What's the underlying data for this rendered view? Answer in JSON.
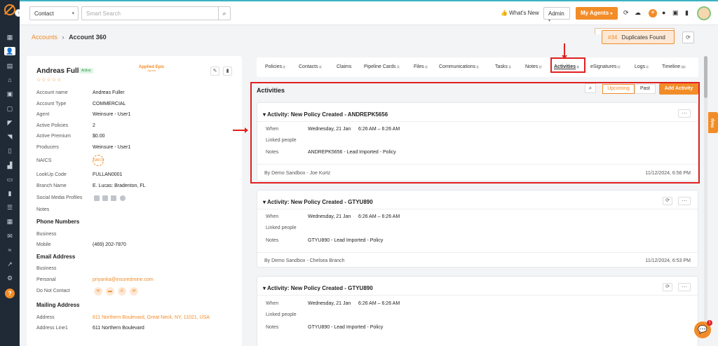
{
  "topbar": {
    "select_label": "Contact",
    "search_placeholder": "Smart Search",
    "whats_new": "👍 What's New",
    "admin_label": "Admin",
    "my_agents_label": "My Agents"
  },
  "breadcrumb": {
    "parent": "Accounts",
    "current": "Account 360"
  },
  "duplicates": {
    "number": "#34",
    "label": "Duplicates Found"
  },
  "account": {
    "name": "Andreas Fuller",
    "status": "Active",
    "stars": "☆☆☆☆☆",
    "applied_epic": "Applied Epic",
    "applied_epic_sub": "Synced",
    "fields": [
      {
        "label": "Account name",
        "value": "Andreas Fuller"
      },
      {
        "label": "Account Type",
        "value": "COMMERCIAL"
      },
      {
        "label": "Agent",
        "value": "Weinsure - User1"
      },
      {
        "label": "Active Policies",
        "value": "2"
      },
      {
        "label": "Active Premium",
        "value": "$0.00"
      },
      {
        "label": "Producers",
        "value": "Weinsure - User1"
      },
      {
        "label": "NAICS",
        "value": ""
      },
      {
        "label": "LookUp Code",
        "value": "FULLAN0001"
      },
      {
        "label": "Branch Name",
        "value": "E. Lucas: Bradenton, FL"
      },
      {
        "label": "Social Media Profiles",
        "value": ""
      },
      {
        "label": "Notes",
        "value": ""
      }
    ],
    "naics_icon_text": "NAICS",
    "phone_section": "Phone Numbers",
    "phone_fields": [
      {
        "label": "Business",
        "value": ""
      },
      {
        "label": "Mobile",
        "value": "(469) 202-7870"
      }
    ],
    "email_section": "Email Address",
    "email_fields": [
      {
        "label": "Business",
        "value": ""
      },
      {
        "label": "Personal",
        "value": "priyanka@insuredmine.com"
      },
      {
        "label": "Do Not Contact",
        "value": ""
      }
    ],
    "mailing_section": "Mailing Address",
    "mailing_fields": [
      {
        "label": "Address",
        "value": "611 Northern Boulevard, Great Neck, NY, 11021, USA"
      },
      {
        "label": "Address Line1",
        "value": "611 Northern Boulevard"
      }
    ]
  },
  "tabs": [
    {
      "label": "Policies",
      "count": "0"
    },
    {
      "label": "Contacts",
      "count": "0"
    },
    {
      "label": "Claims",
      "count": ""
    },
    {
      "label": "Pipeline Cards",
      "count": "0"
    },
    {
      "label": "Files",
      "count": "0"
    },
    {
      "label": "Communications",
      "count": "0"
    },
    {
      "label": "Tasks",
      "count": "0"
    },
    {
      "label": "Notes",
      "count": "0"
    },
    {
      "label": "Activities",
      "count": "3"
    },
    {
      "label": "eSignatures",
      "count": "0"
    },
    {
      "label": "Logs",
      "count": "0"
    },
    {
      "label": "Timeline",
      "count": "34"
    }
  ],
  "activities": {
    "title": "Activities",
    "upcoming_label": "Upcoming",
    "past_label": "Past",
    "add_label": "Add Activity",
    "labels": {
      "when": "When",
      "linked": "Linked people",
      "notes": "Notes"
    },
    "items": [
      {
        "title": "Activity: New Policy Created - ANDREPK5656",
        "when": "Wednesday, 21 Jan",
        "time": "6:26 AM – 6:26 AM",
        "notes": "ANDREPK5656 - Lead Imported - Policy",
        "by": "By Demo Sandbox - Joe Kurtz",
        "date": "11/12/2024, 6:56 PM"
      },
      {
        "title": "Activity: New Policy Created - GTYU890",
        "when": "Wednesday, 21 Jan",
        "time": "6:26 AM – 6:26 AM",
        "notes": "GTYU890 - Lead Imported - Policy",
        "by": "By Demo Sandbox - Chelsea Branch",
        "date": "11/12/2024, 6:53 PM"
      },
      {
        "title": "Activity: New Policy Created - GTYU890",
        "when": "Wednesday, 21 Jan",
        "time": "6:26 AM – 6:26 AM",
        "notes": "GTYU890 - Lead Imported - Policy"
      }
    ]
  },
  "help_label": "Help",
  "chat_badge": "1",
  "colors": {
    "accent": "#f28c28",
    "sidebar": "#1f2a36",
    "annotation": "#e02020"
  }
}
